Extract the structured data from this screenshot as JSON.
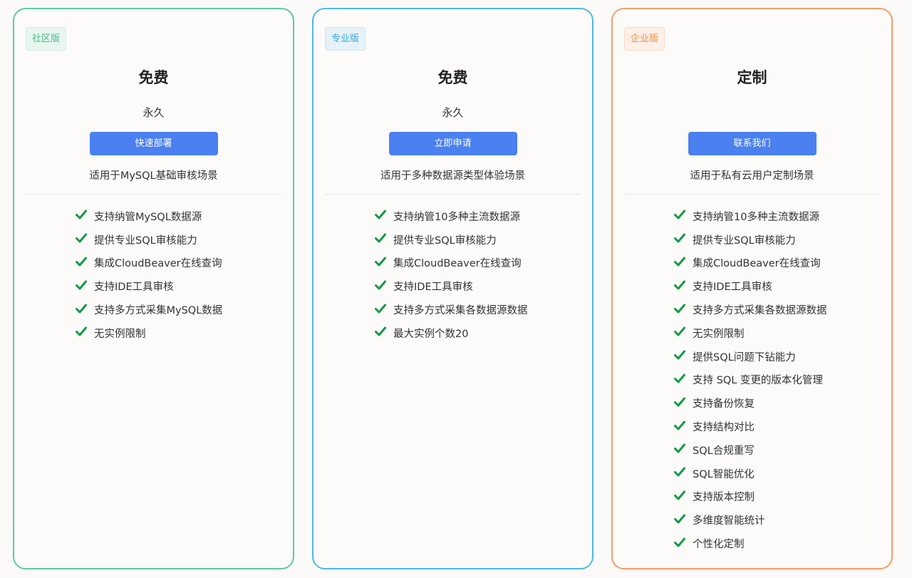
{
  "colors": {
    "community": "#5fc9a0",
    "pro": "#4fb9e3",
    "enterprise": "#f0a06c",
    "button": "#4a80f0",
    "check": "#129946"
  },
  "plans": [
    {
      "badge": "社区版",
      "price": "免费",
      "period": "永久",
      "cta": "快速部署",
      "description": "适用于MySQL基础审核场景",
      "features": [
        "支持纳管MySQL数据源",
        "提供专业SQL审核能力",
        "集成CloudBeaver在线查询",
        "支持IDE工具审核",
        "支持多方式采集MySQL数据",
        "无实例限制"
      ]
    },
    {
      "badge": "专业版",
      "price": "免费",
      "period": "永久",
      "cta": "立即申请",
      "description": "适用于多种数据源类型体验场景",
      "features": [
        "支持纳管10多种主流数据源",
        "提供专业SQL审核能力",
        "集成CloudBeaver在线查询",
        "支持IDE工具审核",
        "支持多方式采集各数据源数据",
        "最大实例个数20"
      ]
    },
    {
      "badge": "企业版",
      "price": "定制",
      "period": "",
      "cta": "联系我们",
      "description": "适用于私有云用户定制场景",
      "features": [
        "支持纳管10多种主流数据源",
        "提供专业SQL审核能力",
        "集成CloudBeaver在线查询",
        "支持IDE工具审核",
        "支持多方式采集各数据源数据",
        "无实例限制",
        "提供SQL问题下钻能力",
        "支持 SQL 变更的版本化管理",
        "支持备份恢复",
        "支持结构对比",
        "SQL合规重写",
        "SQL智能优化",
        "支持版本控制",
        "多维度智能统计",
        "个性化定制"
      ]
    }
  ]
}
